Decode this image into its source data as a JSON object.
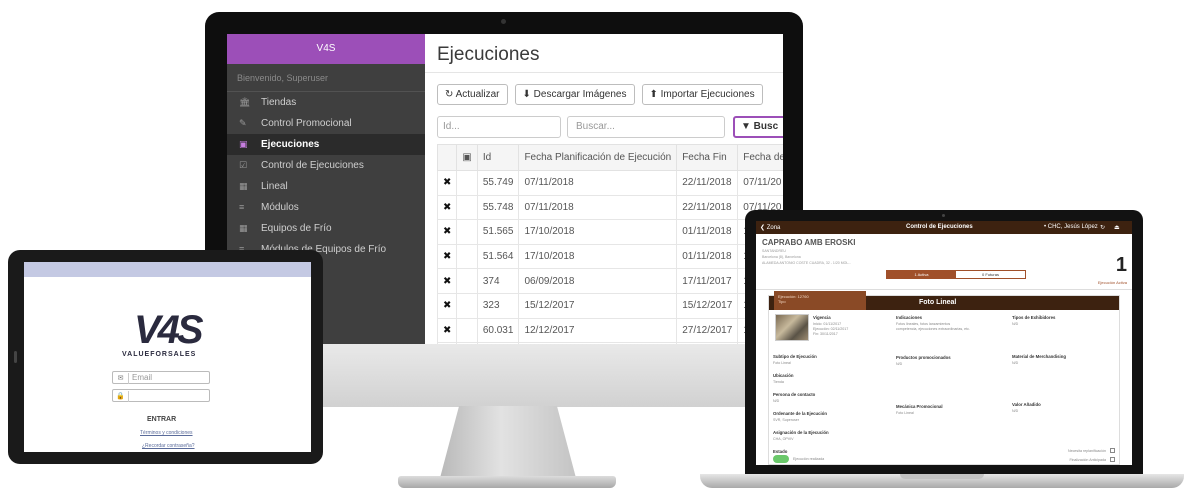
{
  "desktop": {
    "brand": "V4S",
    "welcome": "Bienvenido, Superuser",
    "nav": [
      {
        "icon": "🏛",
        "label": "Tiendas"
      },
      {
        "icon": "✎",
        "label": "Control Promocional"
      },
      {
        "icon": "▣",
        "label": "Ejecuciones"
      },
      {
        "icon": "☑",
        "label": "Control de Ejecuciones"
      },
      {
        "icon": "▦",
        "label": "Lineal"
      },
      {
        "icon": "≡",
        "label": "Módulos"
      },
      {
        "icon": "▦",
        "label": "Equipos de Frío"
      },
      {
        "icon": "≡",
        "label": "Módulos de Equipos de Frío"
      }
    ],
    "title": "Ejecuciones",
    "toolbar": {
      "refresh": "↻ Actualizar",
      "download": "⬇ Descargar Imágenes",
      "import": "⬆ Importar Ejecuciones"
    },
    "filters": {
      "id_placeholder": "Id...",
      "search_placeholder": "Buscar...",
      "search_button": "▼ Busc"
    },
    "table": {
      "headers": [
        "",
        "▣",
        "Id",
        "Fecha Planificación de Ejecución",
        "Fecha Fin",
        "Fecha de"
      ],
      "rows": [
        {
          "id": "55.749",
          "plan": "07/11/2018",
          "fin": "22/11/2018",
          "fecha": "07/11/20"
        },
        {
          "id": "55.748",
          "plan": "07/11/2018",
          "fin": "22/11/2018",
          "fecha": "07/11/20"
        },
        {
          "id": "51.565",
          "plan": "17/10/2018",
          "fin": "01/11/2018",
          "fecha": "17"
        },
        {
          "id": "51.564",
          "plan": "17/10/2018",
          "fin": "01/11/2018",
          "fecha": "17"
        },
        {
          "id": "374",
          "plan": "06/09/2018",
          "fin": "17/11/2017",
          "fecha": "17"
        },
        {
          "id": "323",
          "plan": "15/12/2017",
          "fin": "15/12/2017",
          "fecha": "15"
        },
        {
          "id": "60.031",
          "plan": "12/12/2017",
          "fin": "27/12/2017",
          "fecha": "12"
        },
        {
          "id": "55.923",
          "plan": "12/12/2017",
          "fin": "27/12/2017",
          "fecha": "12"
        }
      ],
      "remove_mark": "✖"
    }
  },
  "tablet": {
    "logo": "V4S",
    "logo_sub": "VALUEFORSALES",
    "email_placeholder": "Email",
    "password_placeholder": "",
    "login_button": "ENTRAR",
    "terms_link": "Términos y condiciones",
    "forgot_link": "¿Recordar contraseña?"
  },
  "laptop": {
    "back": "❮ Zona",
    "screen_title": "Control de Ejecuciones",
    "user": "• CHC, Jesús López",
    "store_name": "CAPRABO AMB EROSKI",
    "store_line1": "SANTANDREU",
    "store_line2": "Barcelona (8), Barcelona",
    "store_line3": "ALAMEDA ANTONIO COSTE CUADRA, 32 - 1/20 MOL...",
    "seg_active": "1 Activa",
    "seg_future": "0 Futuras",
    "active_count": "1",
    "active_label": "Ejecución Activa",
    "badge_title": "Ejecución: 12760",
    "badge_sub": "Tipo",
    "card_title": "Foto Lineal",
    "vigencia_label": "Vigencia",
    "vigencia_lines": [
      "Inicio: 01/11/2017",
      "Ejecución: 02/11/2017",
      "Fin: 30/11/2017"
    ],
    "indicaciones_label": "Indicaciones",
    "indicaciones_text": [
      "Fotos lineales, fotos lanzamientos",
      "competencia, ejecuciones extraordinarias, etc."
    ],
    "tipos_label": "Tipos de Exhibidores",
    "tipos_val": "N/D",
    "subtipo_label": "Subtipo de Ejecución",
    "subtipo_val": "Foto Lineal",
    "productos_label": "Productos promocionados",
    "productos_val": "N/D",
    "material_label": "Material de Merchandising",
    "material_val": "N/D",
    "ubicacion_label": "Ubicación",
    "ubicacion_val": "Tienda",
    "persona_label": "Persona de contacto",
    "persona_val": "N/D",
    "ordenante_label": "Ordenante de la Ejecución",
    "ordenante_val": "SVR, Superuser",
    "mecanica_label": "Mecánica Promocional",
    "mecanica_val": "Foto Lineal",
    "valor_label": "Valor Añadido",
    "valor_val": "N/D",
    "asignacion_label": "Asignación de la Ejecución",
    "asignacion_val": "CHA, OPVIV",
    "estado_label": "Estado",
    "estado_val": "Ejecución realizada",
    "necesita_label": "Necesita replanificación",
    "finalizacion_label": "Finalización Anticipada"
  }
}
